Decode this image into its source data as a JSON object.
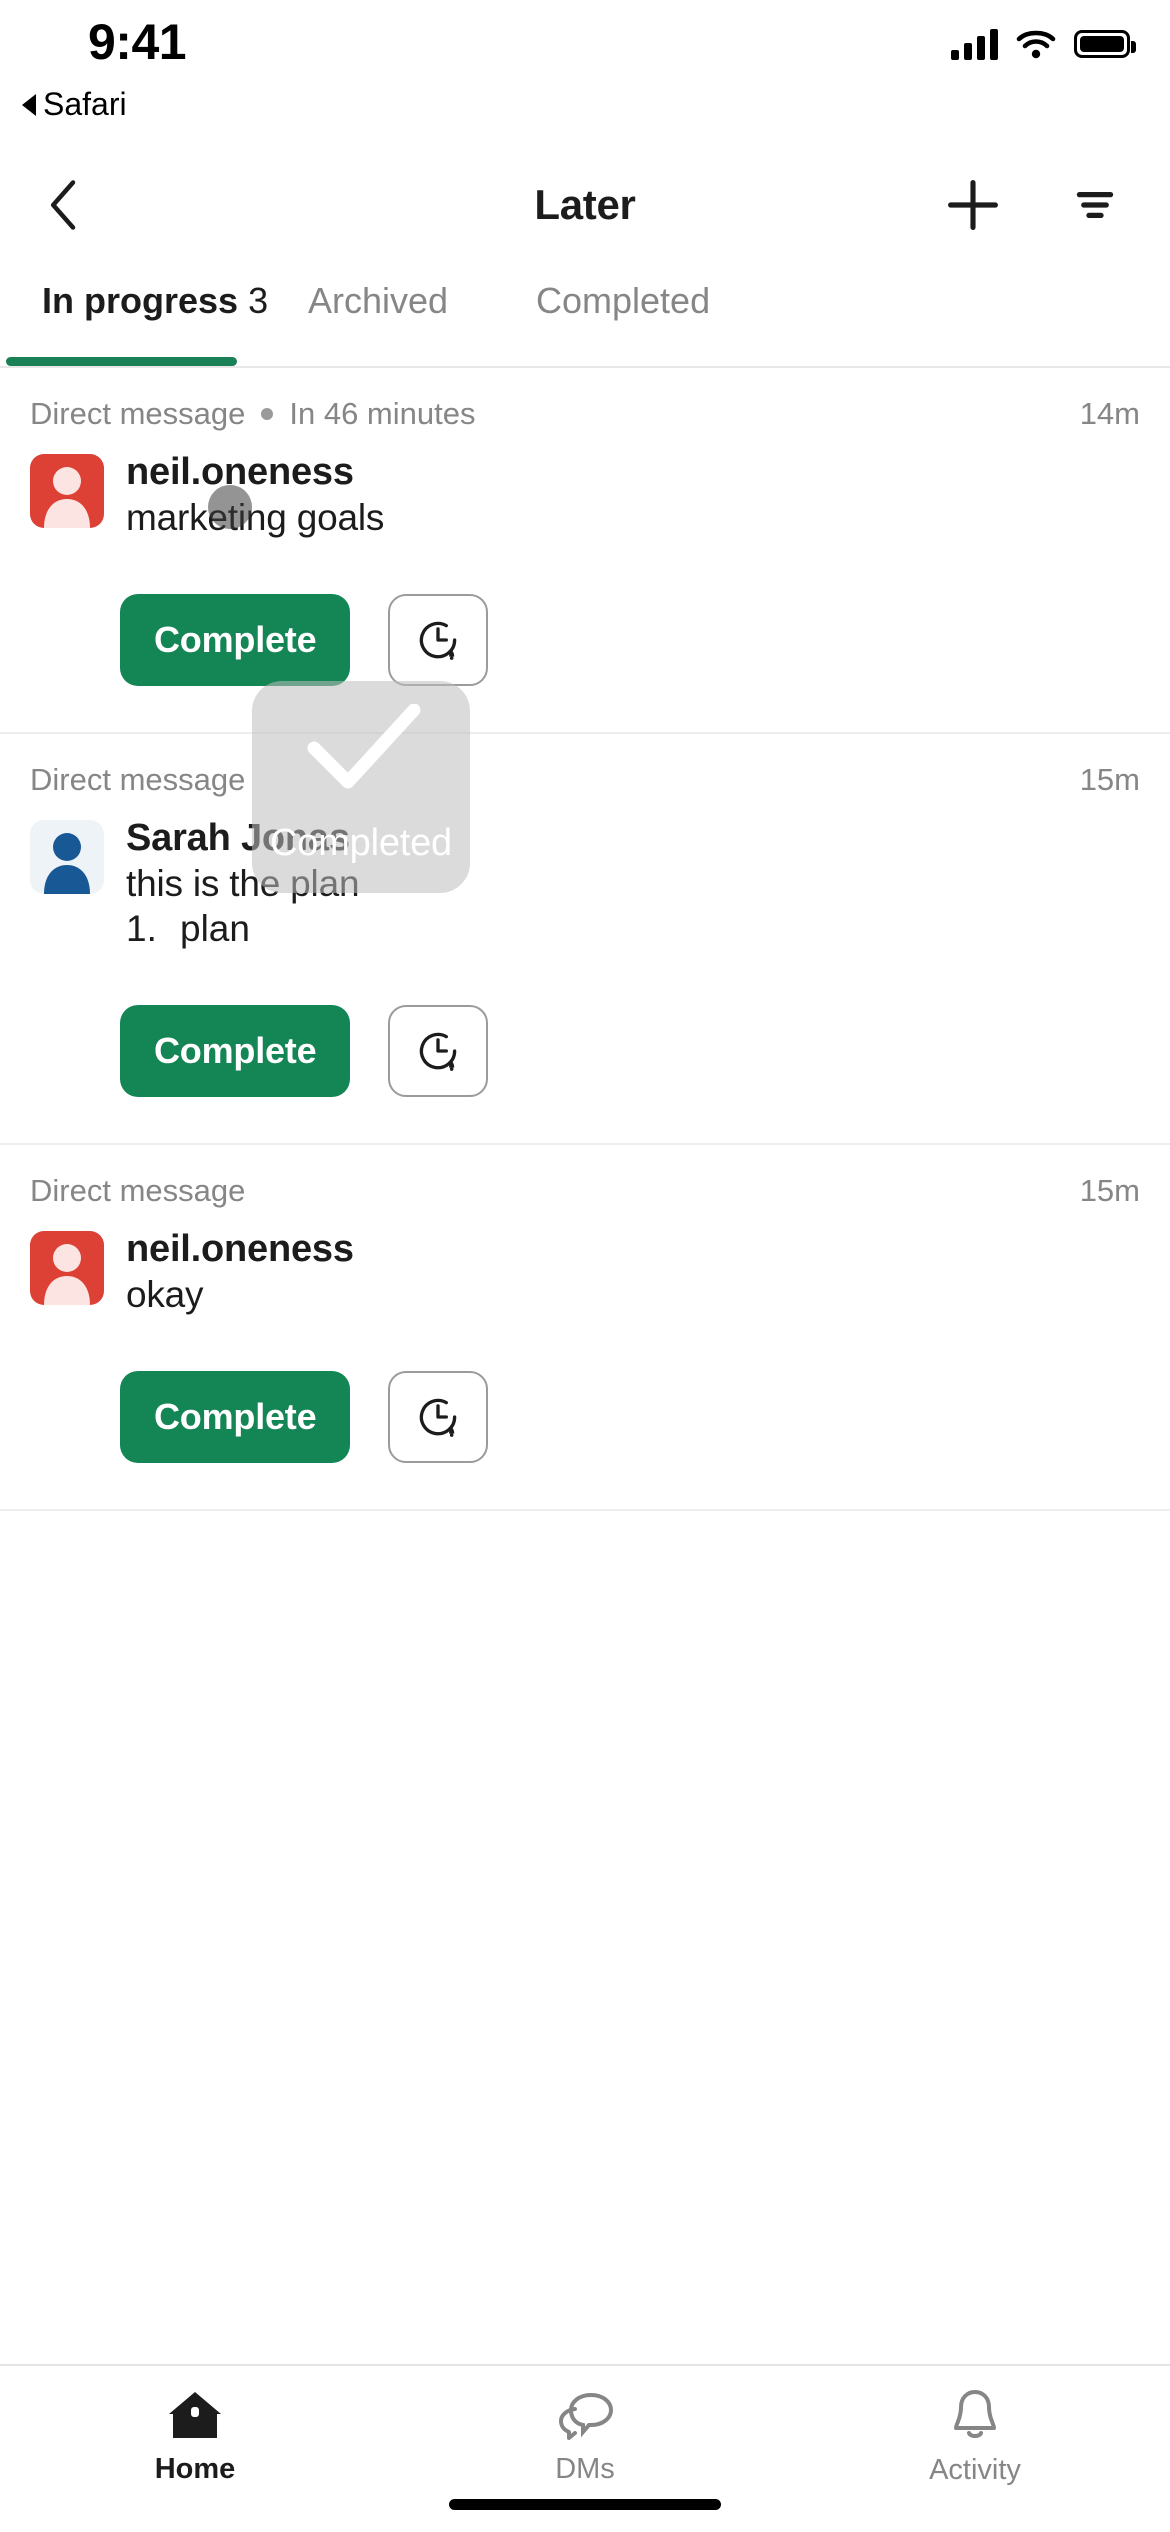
{
  "status_bar": {
    "time": "9:41",
    "return_app": "Safari",
    "signal_icon": "cellular-signal-icon",
    "wifi_icon": "wifi-icon",
    "battery_icon": "battery-full-icon"
  },
  "nav": {
    "back_icon": "chevron-left-icon",
    "title": "Later",
    "add_icon": "plus-icon",
    "filter_icon": "filter-icon"
  },
  "tabs": {
    "items": [
      {
        "label": "In progress",
        "count": "3",
        "active": true
      },
      {
        "label": "Archived",
        "count": "",
        "active": false
      },
      {
        "label": "Completed",
        "count": "",
        "active": false
      }
    ],
    "underline_color": "#1a8055"
  },
  "colors": {
    "green": "#148554",
    "avatar_red": "#dd4135",
    "avatar_red_fg": "#fbe4e2",
    "avatar_blue_bg": "#eef3f8",
    "avatar_blue_fg": "#185894",
    "muted": "#868686",
    "text": "#1d1c1d"
  },
  "cards": [
    {
      "source": "Direct message",
      "due": "In 46 minutes",
      "age": "14m",
      "sender": "neil.oneness",
      "message": "marketing goals",
      "list_item": "",
      "list_number": "",
      "avatar_kind": "red",
      "complete_label": "Complete",
      "remind_icon": "clock-alarm-icon"
    },
    {
      "source": "Direct message",
      "due": "",
      "age": "15m",
      "sender": "Sarah Jonas",
      "message": "this is the plan",
      "list_number": "1.",
      "list_item": "plan",
      "avatar_kind": "blue",
      "complete_label": "Complete",
      "remind_icon": "clock-alarm-icon"
    },
    {
      "source": "Direct message",
      "due": "",
      "age": "15m",
      "sender": "neil.oneness",
      "message": "okay",
      "list_item": "",
      "list_number": "",
      "avatar_kind": "red",
      "complete_label": "Complete",
      "remind_icon": "clock-alarm-icon"
    }
  ],
  "toast": {
    "label": "Completed",
    "icon": "checkmark-icon"
  },
  "tabbar": {
    "items": [
      {
        "label": "Home",
        "icon": "home-icon",
        "active": true
      },
      {
        "label": "DMs",
        "icon": "dms-icon",
        "active": false
      },
      {
        "label": "Activity",
        "icon": "bell-icon",
        "active": false
      }
    ]
  }
}
